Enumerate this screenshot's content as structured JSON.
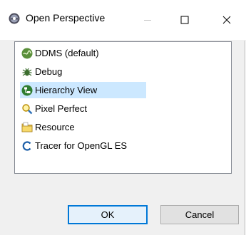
{
  "window": {
    "title": "Open Perspective",
    "icon": "eclipse-perspective-icon",
    "controls": [
      "minimize-icon",
      "maximize-icon",
      "close-icon"
    ]
  },
  "perspectives": [
    {
      "label": "DDMS (default)",
      "icon": "ddms-icon"
    },
    {
      "label": "Debug",
      "icon": "debug-bug-icon"
    },
    {
      "label": "Hierarchy View",
      "icon": "hierarchy-view-icon",
      "selected": true
    },
    {
      "label": "Pixel Perfect",
      "icon": "magnifier-icon"
    },
    {
      "label": "Resource",
      "icon": "folder-icon"
    },
    {
      "label": "Tracer for OpenGL ES",
      "icon": "tracer-icon"
    }
  ],
  "buttons": {
    "ok": "OK",
    "cancel": "Cancel"
  },
  "colors": {
    "selection": "#cce8ff",
    "default_button_border": "#0078d7"
  }
}
